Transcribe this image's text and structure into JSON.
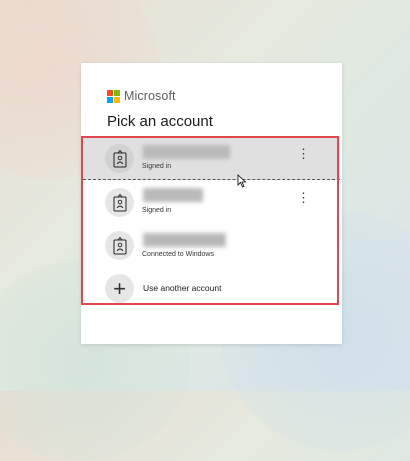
{
  "brand": {
    "name": "Microsoft",
    "logo_colors": [
      "#f25022",
      "#7fba00",
      "#00a4ef",
      "#ffb900"
    ]
  },
  "title": "Pick an account",
  "accounts": [
    {
      "name": "",
      "status": "Signed in",
      "icon": "id-badge-icon",
      "has_more_menu": true,
      "selected": true
    },
    {
      "name": "",
      "status": "Signed in",
      "icon": "id-badge-icon",
      "has_more_menu": true,
      "selected": false
    },
    {
      "name": "",
      "status": "Connected to Windows",
      "icon": "id-badge-icon",
      "has_more_menu": false,
      "selected": false
    }
  ],
  "more_menu_glyph": "⋮",
  "add_account": {
    "label": "Use another account",
    "icon": "plus-icon"
  },
  "colors": {
    "highlight": "#e0484d",
    "selected_row": "#e0e0e0"
  }
}
